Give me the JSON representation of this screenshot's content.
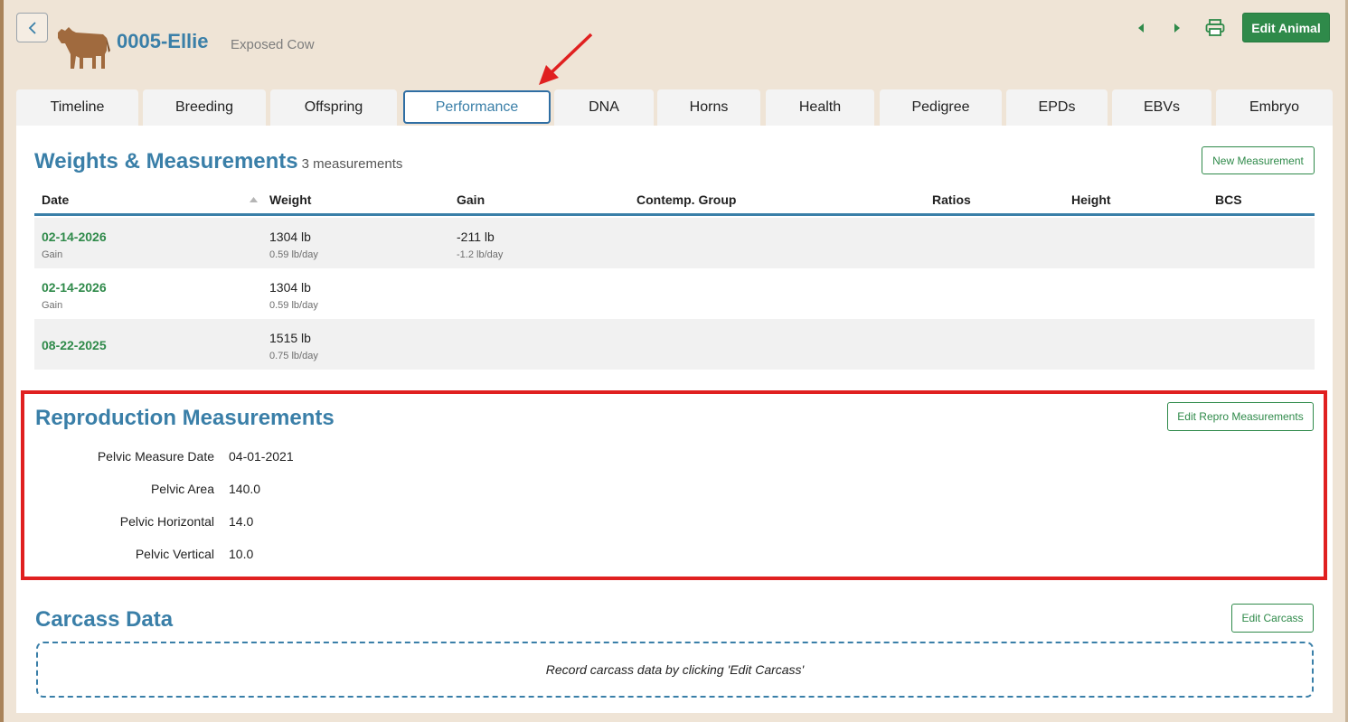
{
  "header": {
    "animal_name": "0005-Ellie",
    "animal_status": "Exposed Cow",
    "edit_button": "Edit Animal",
    "icons": [
      "chevron-left-icon",
      "cow-icon",
      "caret-left-icon",
      "caret-right-icon",
      "printer-icon"
    ]
  },
  "tabs": [
    {
      "label": "Timeline"
    },
    {
      "label": "Breeding"
    },
    {
      "label": "Offspring"
    },
    {
      "label": "Performance",
      "active": true
    },
    {
      "label": "DNA"
    },
    {
      "label": "Horns"
    },
    {
      "label": "Health"
    },
    {
      "label": "Pedigree"
    },
    {
      "label": "EPDs"
    },
    {
      "label": "EBVs"
    },
    {
      "label": "Embryo"
    }
  ],
  "weights": {
    "title": "Weights & Measurements",
    "count": "3 measurements",
    "new_button": "New Measurement",
    "columns": [
      "Date",
      "Weight",
      "Gain",
      "Contemp. Group",
      "Ratios",
      "Height",
      "BCS"
    ],
    "rows": [
      {
        "date": "02-14-2026",
        "date_sub": "Gain",
        "weight": "1304 lb",
        "weight_sub": "0.59 lb/day",
        "gain": "-211 lb",
        "gain_sub": "-1.2 lb/day"
      },
      {
        "date": "02-14-2026",
        "date_sub": "Gain",
        "weight": "1304 lb",
        "weight_sub": "0.59 lb/day",
        "gain": "",
        "gain_sub": ""
      },
      {
        "date": "08-22-2025",
        "date_sub": "",
        "weight": "1515 lb",
        "weight_sub": "0.75 lb/day",
        "gain": "",
        "gain_sub": ""
      }
    ]
  },
  "repro": {
    "title": "Reproduction Measurements",
    "edit_button": "Edit Repro Measurements",
    "fields": [
      {
        "label": "Pelvic Measure Date",
        "value": "04-01-2021"
      },
      {
        "label": "Pelvic Area",
        "value": "140.0"
      },
      {
        "label": "Pelvic Horizontal",
        "value": "14.0"
      },
      {
        "label": "Pelvic Vertical",
        "value": "10.0"
      }
    ]
  },
  "carcass": {
    "title": "Carcass Data",
    "edit_button": "Edit Carcass",
    "empty_message": "Record carcass data by clicking 'Edit Carcass'"
  },
  "colors": {
    "brand_blue": "#3a7fa8",
    "brand_green": "#2f8a4a",
    "highlight_red": "#e02020",
    "background": "#efe4d6"
  }
}
